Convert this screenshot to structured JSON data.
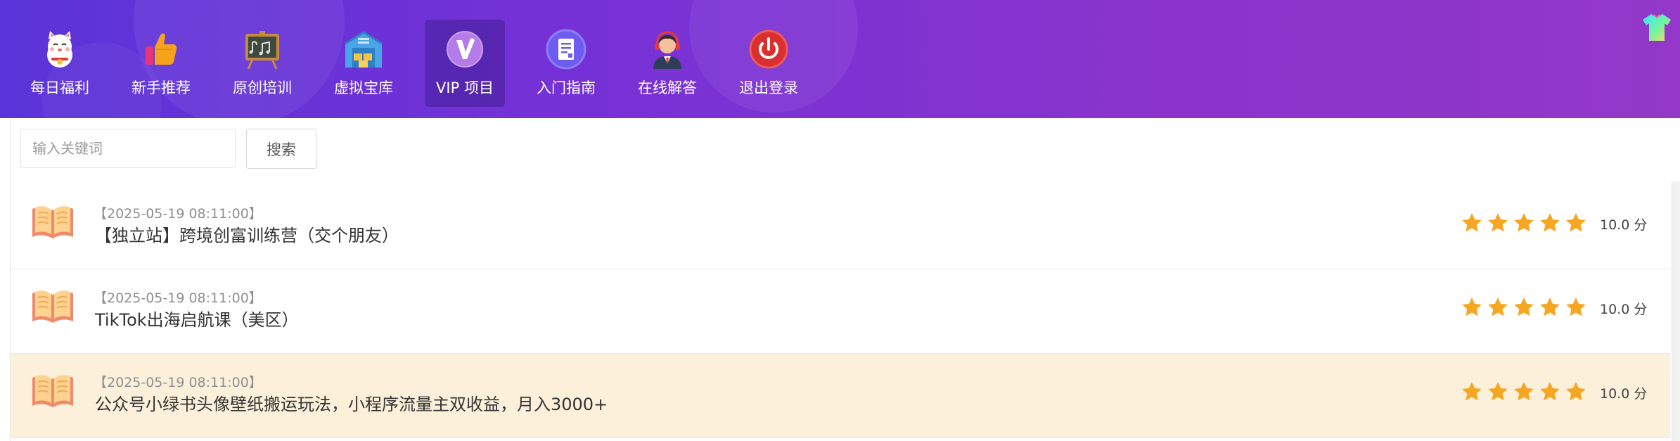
{
  "nav": {
    "items": [
      {
        "label": "每日福利",
        "icon": "lucky-cat-icon"
      },
      {
        "label": "新手推荐",
        "icon": "thumbs-up-icon"
      },
      {
        "label": "原创培训",
        "icon": "chalkboard-icon"
      },
      {
        "label": "虚拟宝库",
        "icon": "warehouse-icon"
      },
      {
        "label": "VIP 项目",
        "icon": "vip-v-icon",
        "active": true
      },
      {
        "label": "入门指南",
        "icon": "document-icon"
      },
      {
        "label": "在线解答",
        "icon": "support-agent-icon"
      },
      {
        "label": "退出登录",
        "icon": "power-icon"
      }
    ]
  },
  "search": {
    "placeholder": "输入关键词",
    "button_label": "搜索"
  },
  "list": {
    "items": [
      {
        "date": "【2025-05-19 08:11:00】",
        "title": "【独立站】跨境创富训练营（交个朋友）",
        "rating": 5,
        "score": "10.0 分"
      },
      {
        "date": "【2025-05-19 08:11:00】",
        "title": "TikTok出海启航课（美区）",
        "rating": 5,
        "score": "10.0 分"
      },
      {
        "date": "【2025-05-19 08:11:00】",
        "title": "公众号小绿书头像壁纸搬运玩法，小程序流量主双收益，月入3000+",
        "rating": 5,
        "score": "10.0 分",
        "highlighted": true
      }
    ]
  },
  "colors": {
    "header_gradient_start": "#5a34d8",
    "header_gradient_end": "#9338c9",
    "star": "#f5a623",
    "highlight_row": "#fcf0da"
  }
}
